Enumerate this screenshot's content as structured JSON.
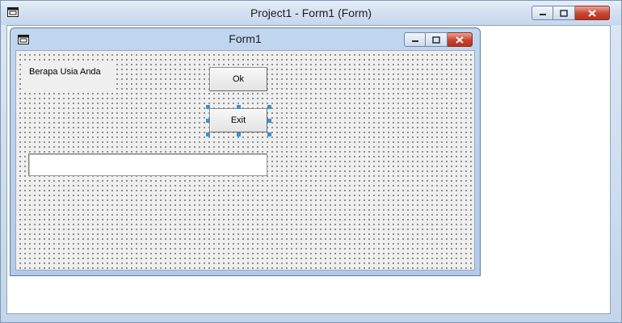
{
  "window": {
    "title": "Project1 - Form1 (Form)"
  },
  "form": {
    "title": "Form1",
    "label_text": "Berapa Usia Anda",
    "ok_button_label": "Ok",
    "exit_button_label": "Exit",
    "textbox_value": "",
    "selected_control": "exit-button"
  },
  "colors": {
    "selection_handle": "#3d8fd6",
    "close_button": "#c7432f",
    "grid_dot": "#3a3a3a"
  },
  "icons": {
    "app_icon": "form-window-icon",
    "minimize": "minimize-icon",
    "maximize": "maximize-icon",
    "close": "close-icon"
  }
}
